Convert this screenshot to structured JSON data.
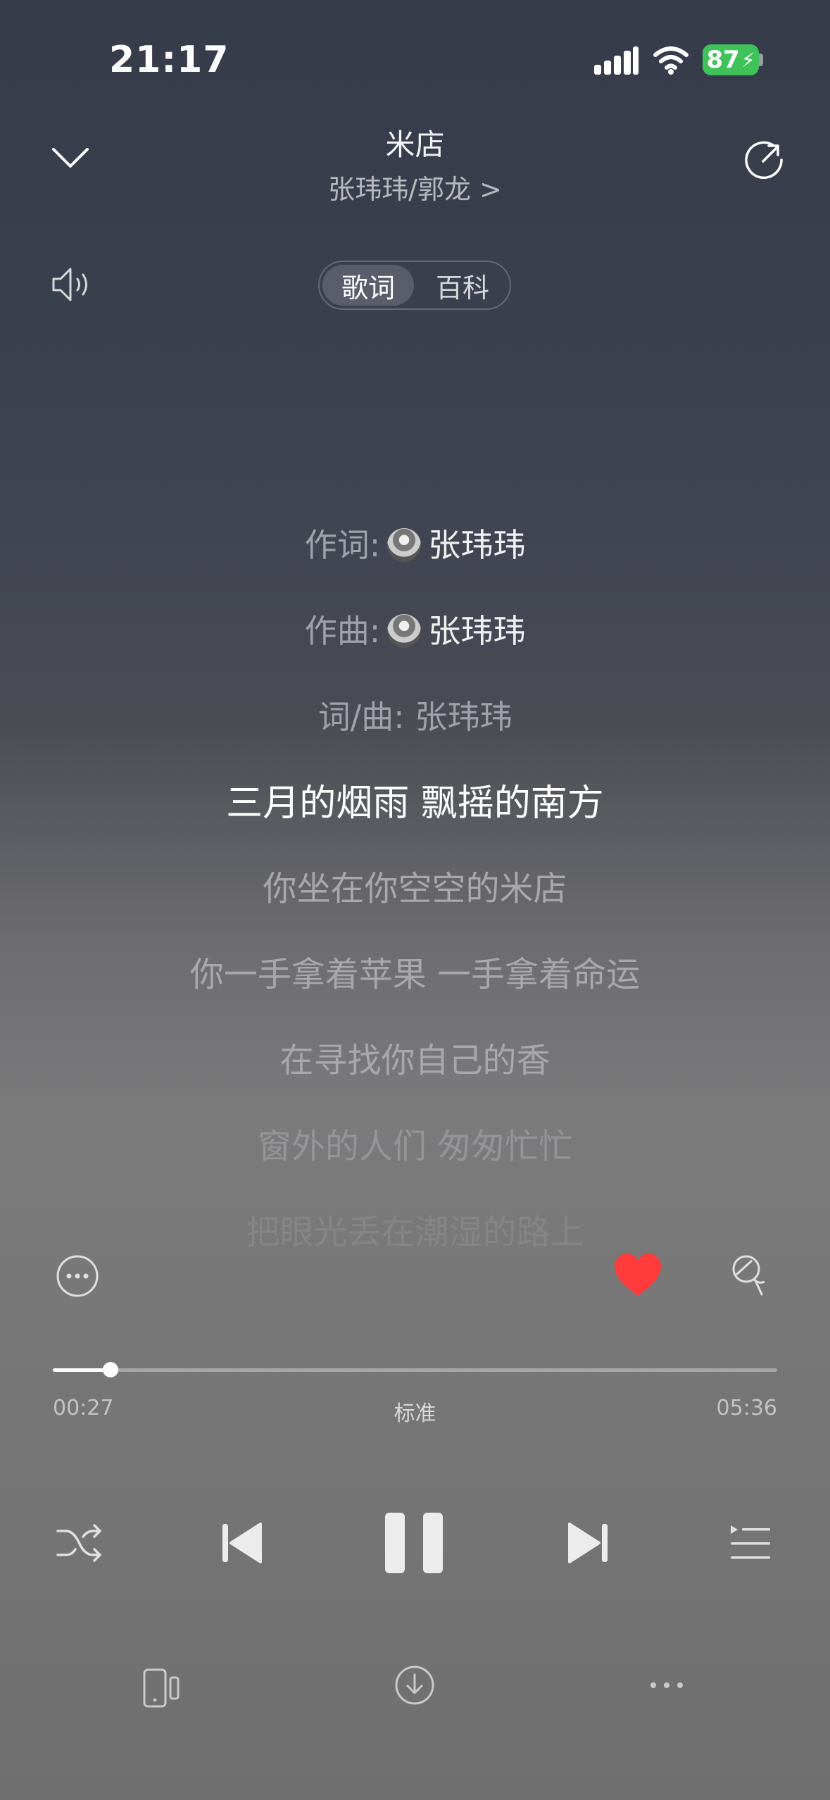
{
  "status": {
    "time": "21:17",
    "battery": "87"
  },
  "header": {
    "song_title": "米店",
    "artists": "张玮玮/郭龙 >"
  },
  "tabs": [
    {
      "label": "歌词"
    },
    {
      "label": "百科"
    }
  ],
  "credits": [
    {
      "label": "作词:",
      "name": "张玮玮"
    },
    {
      "label": "作曲:",
      "name": "张玮玮"
    },
    {
      "label": "词/曲:",
      "name": "张玮玮"
    }
  ],
  "lyrics": [
    "三月的烟雨 飘摇的南方",
    "你坐在你空空的米店",
    "你一手拿着苹果 一手拿着命运",
    "在寻找你自己的香",
    "窗外的人们 匆匆忙忙",
    "把眼光丢在潮湿的路上"
  ],
  "player": {
    "current_time": "00:27",
    "quality": "标准",
    "total_time": "05:36",
    "progress": 0.08,
    "liked": true
  },
  "colors": {
    "heart": "#ff3b3b",
    "battery": "#3fc25a"
  },
  "icons": [
    "chevron-down-icon",
    "share-icon",
    "volume-icon",
    "more-circle-icon",
    "heart-icon",
    "mic-icon",
    "shuffle-icon",
    "previous-icon",
    "pause-icon",
    "next-icon",
    "playlist-icon",
    "device-icon",
    "download-icon",
    "more-horizontal-icon"
  ]
}
